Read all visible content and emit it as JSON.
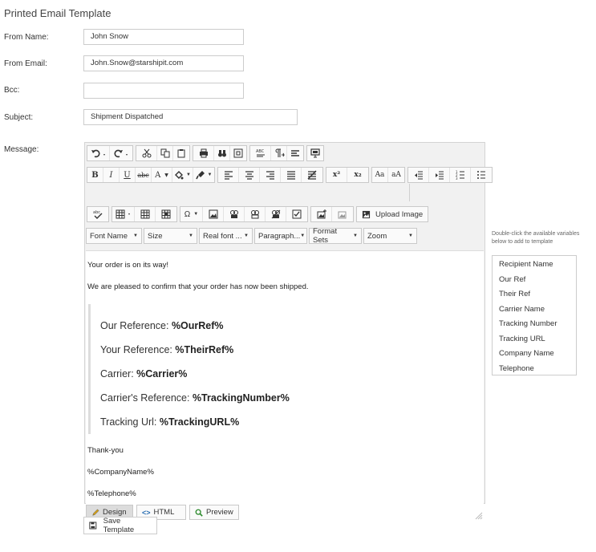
{
  "page": {
    "title": "Printed Email Template"
  },
  "form": {
    "from_name": {
      "label": "From Name:",
      "value": "John Snow"
    },
    "from_email": {
      "label": "From Email:",
      "value": "John.Snow@starshipit.com"
    },
    "bcc": {
      "label": "Bcc:",
      "value": ""
    },
    "subject": {
      "label": "Subject:",
      "value": "Shipment Dispatched"
    },
    "message_label": "Message:"
  },
  "toolbar": {
    "upload_image": "Upload Image",
    "font_name": "Font Name",
    "size": "Size",
    "real_font": "Real font ...",
    "paragraph": "Paragraph...",
    "format_sets": "Format Sets",
    "zoom": "Zoom",
    "bold": "B",
    "italic": "I",
    "underline": "U",
    "strike": "abc",
    "font_color": "A",
    "superscript": "x²",
    "subscript": "x₂",
    "uppercase": "Aa",
    "lowercase": "aA",
    "spell": "abc",
    "omega": "Ω"
  },
  "content": {
    "line1": "Your order is on its way!",
    "line2": "We are pleased to confirm that your order has now been shipped.",
    "refs": [
      {
        "label": "Our Reference: ",
        "value": "%OurRef%"
      },
      {
        "label": "Your Reference: ",
        "value": "%TheirRef%"
      },
      {
        "label": "Carrier: ",
        "value": "%Carrier%"
      },
      {
        "label": "Carrier's Reference: ",
        "value": "%TrackingNumber%"
      },
      {
        "label": "Tracking Url: ",
        "value": "%TrackingURL%"
      }
    ],
    "thanks": "Thank-you",
    "company": "%CompanyName%",
    "telephone": "%Telephone%"
  },
  "modes": {
    "design": "Design",
    "html": "HTML",
    "preview": "Preview"
  },
  "save_button": "Save Template",
  "variables": {
    "hint": "Double-click the available variables below to add to template",
    "items": [
      "Recipient Name",
      "Our Ref",
      "Their Ref",
      "Carrier Name",
      "Tracking Number",
      "Tracking URL",
      "Company Name",
      "Telephone"
    ]
  },
  "colors": {
    "border": "#cccccc",
    "toolbar_bg": "#f1f1f1",
    "active_tab": "#dcdcdc"
  }
}
